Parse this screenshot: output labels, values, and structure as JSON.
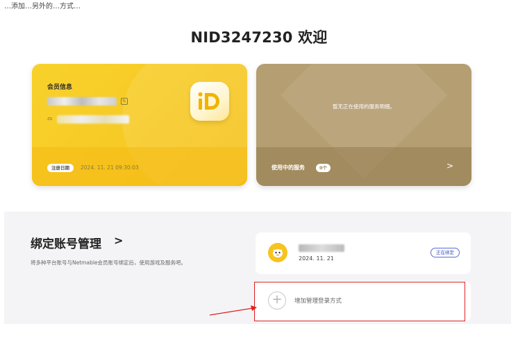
{
  "top_caption": "…添加…另外的…方式…",
  "welcome": "NID3247230 欢迎",
  "member_card": {
    "title": "会员信息",
    "email_prefix": "zs",
    "reg_label": "注册日期",
    "reg_date": "2024. 11. 21 09:30:03",
    "logo_text": "iD"
  },
  "service_card": {
    "empty_message": "暂无正在使用的服务明细。",
    "in_use_label": "使用中的服务",
    "count": "0个",
    "arrow": ">"
  },
  "account_section": {
    "title": "绑定账号管理",
    "chevron": ">",
    "description": "将多种平台账号与Netmable会员账号绑定后，使用游戏及服务吧。",
    "linked": {
      "date": "2024. 11. 21",
      "status": "正在绑定"
    },
    "add_login": {
      "plus": "+",
      "label": "增加管理登录方式"
    }
  },
  "colors": {
    "member_card": "#f7c924",
    "service_card": "#b59e72",
    "highlight": "#e02020",
    "status_badge": "#3d4fc9"
  }
}
